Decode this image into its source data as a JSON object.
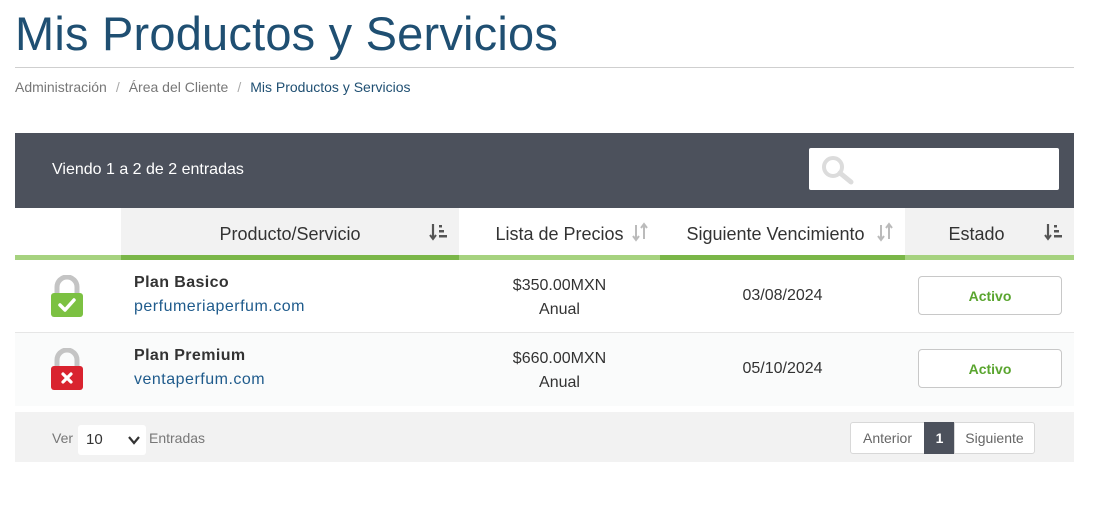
{
  "page": {
    "title": "Mis Productos y Servicios"
  },
  "breadcrumb": {
    "items": [
      "Administración",
      "Área del Cliente"
    ],
    "separator": "/",
    "current": "Mis Productos y Servicios"
  },
  "toolbar": {
    "info": "Viendo 1 a 2 de 2 entradas",
    "search": {
      "value": "",
      "placeholder": ""
    }
  },
  "table": {
    "columns": [
      "Producto/Servicio",
      "Lista de Precios",
      "Siguiente Vencimiento",
      "Estado"
    ],
    "rows": [
      {
        "icon": "lock-check-icon",
        "name": "Plan Basico",
        "domain": "perfumeriaperfum.com",
        "price": "$350.00MXN",
        "cycle": "Anual",
        "due": "03/08/2024",
        "status": "Activo"
      },
      {
        "icon": "lock-x-icon",
        "name": "Plan Premium",
        "domain": "ventaperfum.com",
        "price": "$660.00MXN",
        "cycle": "Anual",
        "due": "05/10/2024",
        "status": "Activo"
      }
    ]
  },
  "footer": {
    "show_label": "Ver",
    "page_length": "10",
    "entries_label": "Entradas",
    "pager": {
      "prev": "Anterior",
      "current": "1",
      "next": "Siguiente"
    }
  },
  "colors": {
    "title": "#1f4f72",
    "toolbar_bg": "#4c515c",
    "accent_green": "#7ab648",
    "status_green": "#5aa52f",
    "lock_green": "#7cc142",
    "lock_red": "#d9232f"
  }
}
